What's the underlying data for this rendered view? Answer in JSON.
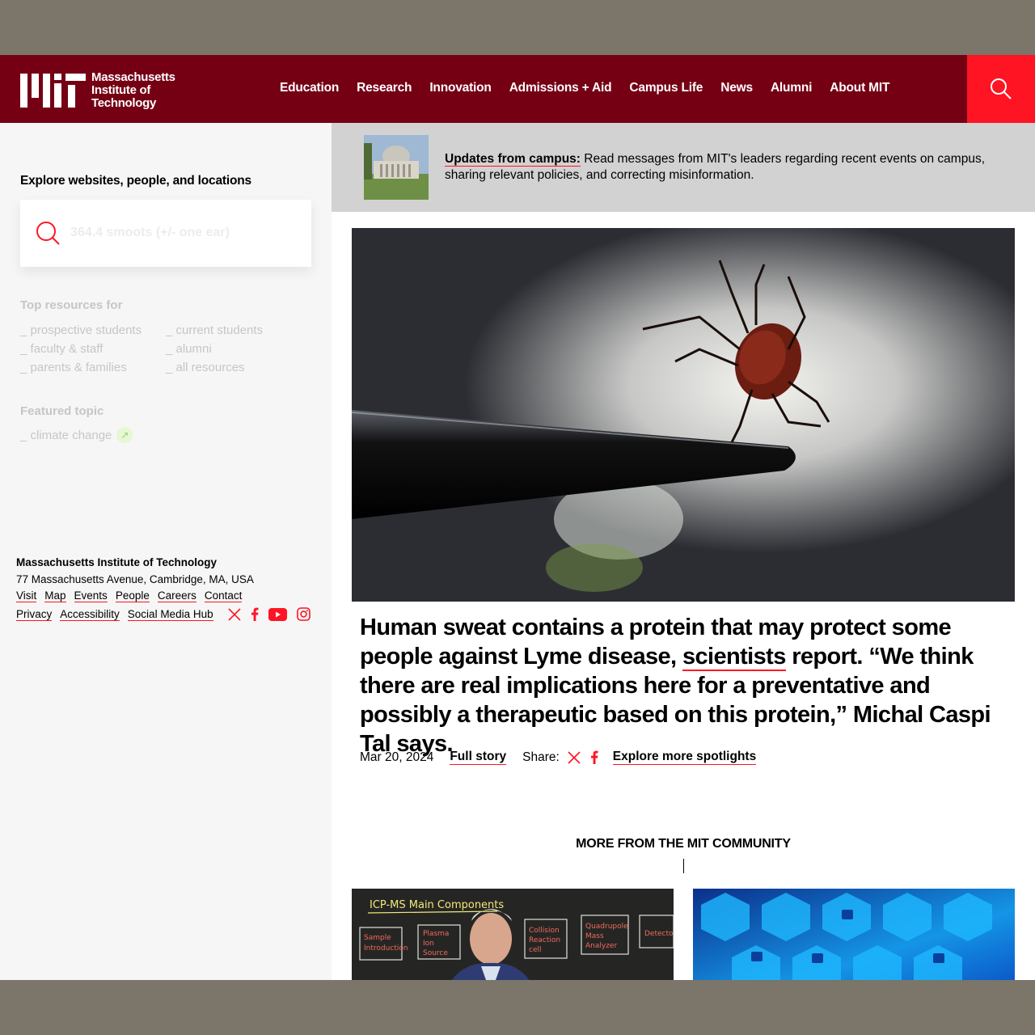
{
  "header": {
    "logo_text": [
      "Massachusetts",
      "Institute of",
      "Technology"
    ],
    "nav": [
      "Education",
      "Research",
      "Innovation",
      "Admissions + Aid",
      "Campus Life",
      "News",
      "Alumni",
      "About MIT"
    ],
    "colors": {
      "brand": "#750014",
      "accent": "#ff1423"
    }
  },
  "sidebar": {
    "explore_label": "Explore websites, people, and locations",
    "search_placeholder": "364.4 smoots (+/- one ear)",
    "top_resources_heading": "Top resources for",
    "resources": [
      "_ prospective students",
      "_ current students",
      "_ faculty & staff",
      "_ alumni",
      "_ parents & families",
      "_ all resources"
    ],
    "featured_heading": "Featured topic",
    "featured_topic": "_ climate change",
    "footer": {
      "name": "Massachusetts Institute of Technology",
      "address": "77 Massachusetts Avenue, Cambridge, MA, USA",
      "links_row1": [
        "Visit",
        "Map",
        "Events",
        "People",
        "Careers",
        "Contact"
      ],
      "links_row2": [
        "Privacy",
        "Accessibility",
        "Social Media Hub"
      ],
      "social_icons": [
        "x-icon",
        "facebook-icon",
        "youtube-icon",
        "instagram-icon"
      ]
    }
  },
  "alert": {
    "title": "Updates from campus:",
    "message": " Read messages from MIT's leaders regarding recent events on campus, sharing relevant policies, and correcting misinformation."
  },
  "spotlight": {
    "headline_before": "Human sweat contains a protein that may protect some people against Lyme disease, ",
    "headline_link": "scientists",
    "headline_after": " report. “We think there are real implications here for a preventative and possibly a therapeutic based on this protein,” Michal Caspi Tal says.",
    "date": "Mar 20, 2024",
    "full_story": "Full story",
    "share_label": "Share:",
    "explore_more": "Explore more spotlights"
  },
  "more": {
    "heading": "MORE FROM THE MIT COMMUNITY",
    "card1_board_title": "ICP-MS Main Components",
    "card1_boxes": [
      "Sample Introduction",
      "Plasma Ion Source",
      "Collision Reaction Cell",
      "Quadrupole Mass Analyzer",
      "Detector"
    ]
  }
}
